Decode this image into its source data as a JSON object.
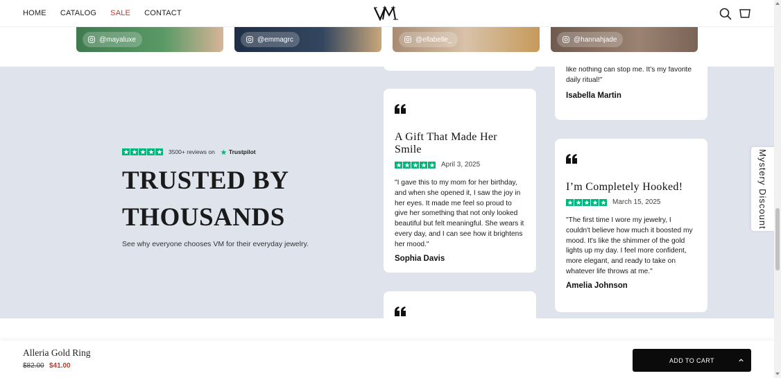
{
  "header": {
    "nav": [
      "HOME",
      "CATALOG",
      "SALE",
      "CONTACT"
    ],
    "logo_text": "VM",
    "icons": [
      "search-icon",
      "cart-icon"
    ],
    "sale_color": "#c0392b"
  },
  "instagram": [
    {
      "handle": "@mayaluxe",
      "bg": "#4e8c5c"
    },
    {
      "handle": "@emmagrc",
      "bg": "#2e3e57"
    },
    {
      "handle": "@ellabelle_",
      "bg": "#b79b80"
    },
    {
      "handle": "@hannahjade",
      "bg": "#8a7262"
    }
  ],
  "intro": {
    "reviews_count": "3500+ reviews on",
    "trustpilot": "Trustpilot",
    "title": "TRUSTED BY THOUSANDS",
    "subtitle": "See why everyone chooses VM for their everyday jewelry."
  },
  "reviews": {
    "partial_top_right": {
      "text": "like nothing can stop me. It’s my favorite daily ritual!\"",
      "author": "Isabella Martin"
    },
    "gift": {
      "title": "A Gift That Made Her Smile",
      "date": "April 3, 2025",
      "text": "\"I gave this to my mom for her birthday, and when she opened it, I saw the joy in her eyes. It made me feel so proud to give her something that not only looked beautiful but felt meaningful. She wears it every day, and I can see how it brightens her mood.\"",
      "author": "Sophia Davis"
    },
    "hooked": {
      "title": "I’m Completely Hooked!",
      "date": "March 15, 2025",
      "text": "\"The first time I wore my jewelry, I couldn't believe how much it boosted my mood. It's like the shimmer of the gold lights up my day. I feel more confident, more elegant, and ready to take on whatever life throws at me.\"",
      "author": "Amelia Johnson"
    }
  },
  "mystery_tab": "Mystery Discount",
  "sticky": {
    "product": "Alleria Gold Ring",
    "old_price": "$82.00",
    "new_price": "$41.00",
    "button": "ADD TO CART"
  },
  "colors": {
    "band_bg": "#dfe3ec",
    "trustpilot_green": "#00b67a",
    "button_bg": "#0b0b0b"
  }
}
